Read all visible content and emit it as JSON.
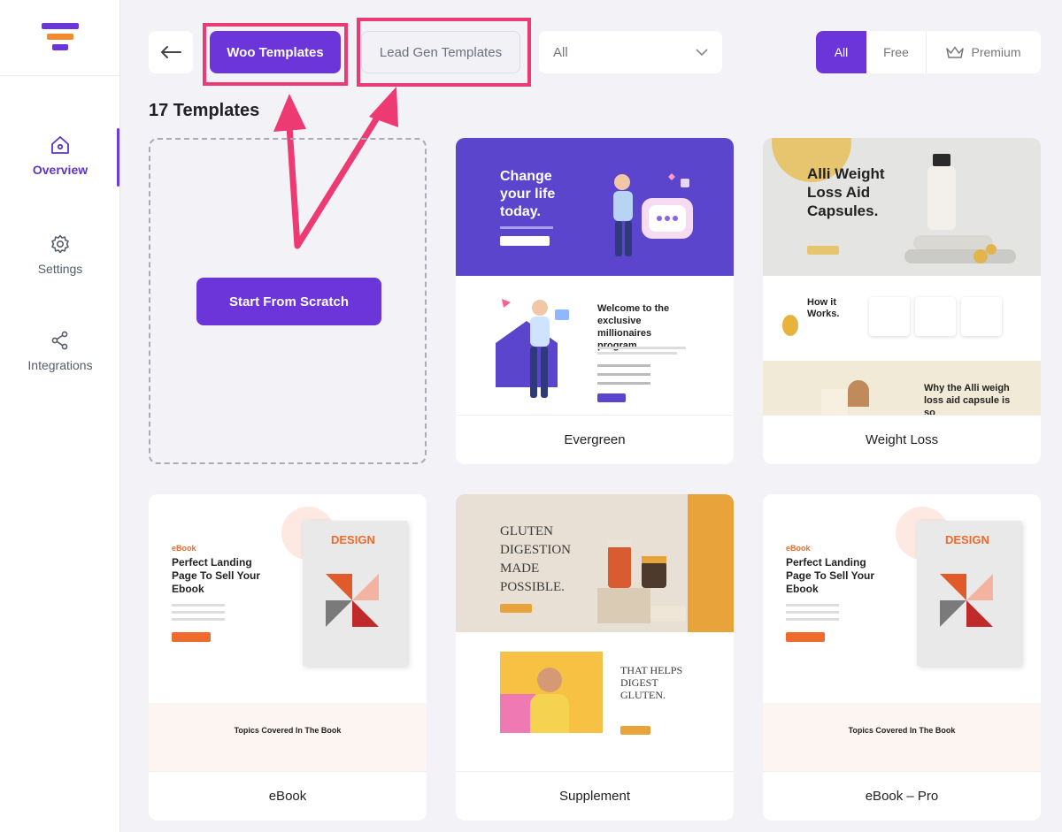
{
  "sidebar": {
    "items": [
      {
        "label": "Overview",
        "icon": "home-icon",
        "active": true
      },
      {
        "label": "Settings",
        "icon": "gear-icon"
      },
      {
        "label": "Integrations",
        "icon": "share-icon"
      }
    ]
  },
  "toolbar": {
    "back_icon": "arrow-left-icon",
    "tabs": [
      {
        "label": "Woo Templates",
        "active": true
      },
      {
        "label": "Lead Gen Templates"
      }
    ],
    "filter_value": "All",
    "segments": [
      {
        "label": "All",
        "active": true
      },
      {
        "label": "Free"
      },
      {
        "label": "Premium",
        "icon": "crown-icon"
      }
    ]
  },
  "count_label": "17 Templates",
  "scratch_label": "Start From Scratch",
  "colors": {
    "accent": "#6b35d9",
    "highlight": "#ee3a72"
  },
  "templates": [
    {
      "name": "Evergreen",
      "hero_text": "Change your life today.",
      "section_text": "Welcome to the exclusive millionaires program."
    },
    {
      "name": "Weight Loss",
      "hero_text": "Alli Weight Loss Aid Capsules.",
      "section_text": "How it Works.",
      "footer_text": "Why the Alli weigh loss aid capsule is so"
    },
    {
      "name": "eBook",
      "badge": "eBook",
      "hero_text": "Perfect Landing Page To Sell Your Ebook",
      "cover_text": "DESIGN",
      "section_text": "Topics Covered In The Book"
    },
    {
      "name": "Supplement",
      "hero_text": "GLUTEN DIGESTION MADE POSSIBLE.",
      "section_text": "THAT HELPS DIGEST GLUTEN."
    },
    {
      "name": "eBook – Pro",
      "badge": "eBook",
      "hero_text": "Perfect Landing Page To Sell Your Ebook",
      "cover_text": "DESIGN",
      "section_text": "Topics Covered In The Book"
    }
  ]
}
